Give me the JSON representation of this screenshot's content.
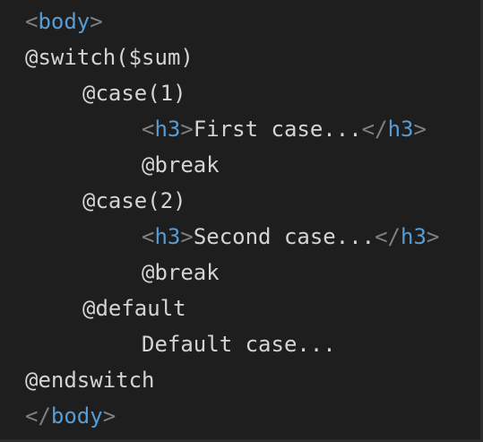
{
  "code": {
    "lines": [
      {
        "parts": {
          "open": "<",
          "tag": "body",
          "close": ">"
        }
      },
      {
        "text": "@switch($sum)"
      },
      {
        "text": "@case(1)"
      },
      {
        "parts": {
          "open": "<",
          "tag": "h3",
          "close": ">",
          "text": "First case...",
          "end_open": "</",
          "end_tag": "h3",
          "end_close": ">"
        }
      },
      {
        "text": "@break"
      },
      {
        "text": "@case(2)"
      },
      {
        "parts": {
          "open": "<",
          "tag": "h3",
          "close": ">",
          "text": "Second case...",
          "end_open": "</",
          "end_tag": "h3",
          "end_close": ">"
        }
      },
      {
        "text": "@break"
      },
      {
        "text": "@default"
      },
      {
        "text": "Default case..."
      },
      {
        "text": "@endswitch"
      },
      {
        "parts": {
          "open": "</",
          "tag": "body",
          "close": ">"
        }
      }
    ]
  },
  "colors": {
    "background": "#1e1e1e",
    "text": "#d4d4d4",
    "tag_bracket": "#808080",
    "tag_name": "#569cd6"
  }
}
